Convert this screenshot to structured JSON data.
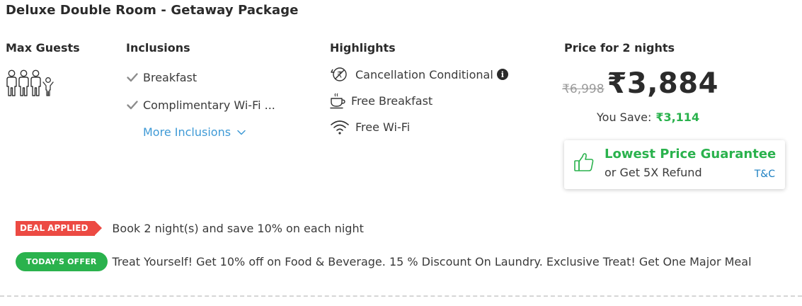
{
  "room": {
    "title": "Deluxe Double Room - Getaway Package"
  },
  "columns": {
    "guests": "Max Guests",
    "inclusions": "Inclusions",
    "highlights": "Highlights",
    "price": "Price for 2 nights"
  },
  "guests": {
    "adults": 3,
    "children": 1,
    "icons": [
      "adult-icon",
      "adult-icon",
      "adult-icon",
      "child-icon"
    ]
  },
  "inclusions": {
    "items": [
      "Breakfast",
      "Complimentary Wi-Fi ..."
    ],
    "more_label": "More Inclusions"
  },
  "highlights": {
    "items": [
      {
        "icon": "cancellation-rupee-icon",
        "label": "Cancellation Conditional",
        "info": "i"
      },
      {
        "icon": "coffee-cup-icon",
        "label": "Free Breakfast"
      },
      {
        "icon": "wifi-icon",
        "label": "Free Wi-Fi"
      }
    ]
  },
  "price": {
    "old": "₹6,998",
    "new": "₹3,884",
    "save_label": "You Save:",
    "save_amount": "₹3,114"
  },
  "guarantee": {
    "title": "Lowest Price Guarantee",
    "subtitle": "or Get 5X Refund",
    "tc": "T&C"
  },
  "deal": {
    "tag": "DEAL APPLIED",
    "text": "Book 2 night(s) and save 10% on each night"
  },
  "offer": {
    "tag": "TODAY'S OFFER",
    "text": "Treat Yourself! Get 10% off on Food & Beverage. 15 % Discount On Laundry. Exclusive Treat! Get One Major Meal"
  },
  "colors": {
    "green": "#2ab24d",
    "red": "#ec4a43",
    "link": "#3f9ad6",
    "tc": "#1b7fc2"
  }
}
